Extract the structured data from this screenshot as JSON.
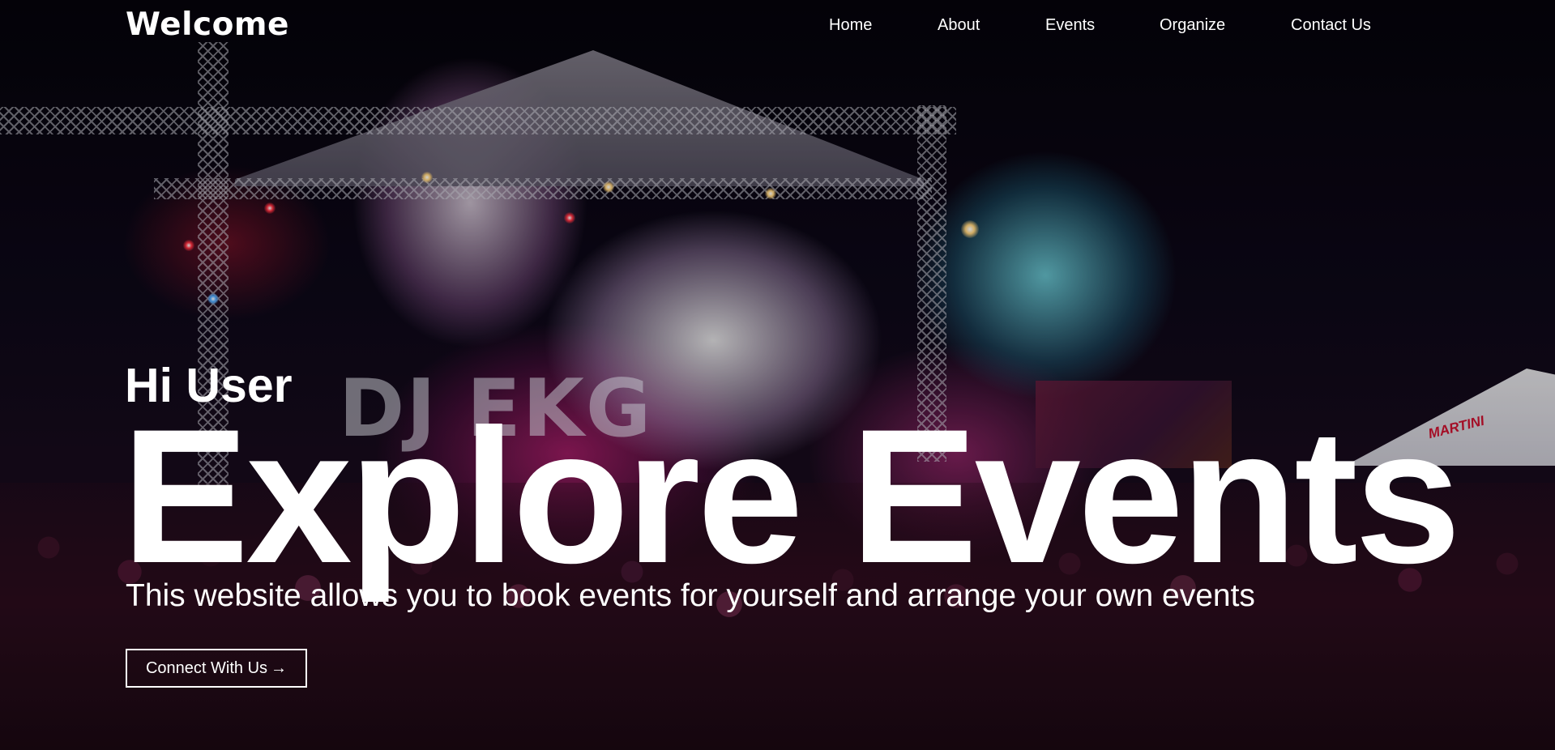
{
  "header": {
    "brand": "Welcome",
    "nav": [
      {
        "label": "Home"
      },
      {
        "label": "About"
      },
      {
        "label": "Events"
      },
      {
        "label": "Organize"
      },
      {
        "label": "Contact Us"
      }
    ]
  },
  "hero": {
    "greeting": "Hi User",
    "headline_word_1": "Explore",
    "headline_word_2": "Events",
    "subtitle": "This website allows you to book events for yourself and arrange your own events",
    "cta_label": "Connect With Us",
    "cta_icon": "arrow-right-icon",
    "background_image": "concert-crowd-stage-photo"
  },
  "colors": {
    "text": "#ffffff",
    "background": "#0b0610"
  }
}
